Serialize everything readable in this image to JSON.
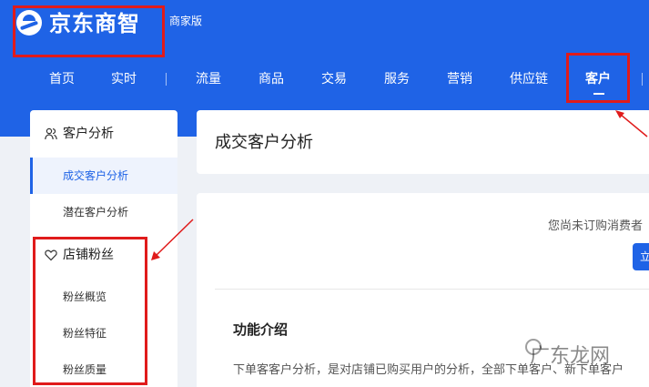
{
  "header": {
    "brand": "京东商智",
    "edition": "商家版"
  },
  "nav": {
    "items": [
      "首页",
      "实时",
      "流量",
      "商品",
      "交易",
      "服务",
      "营销",
      "供应链",
      "客户"
    ],
    "active": "客户"
  },
  "sidebar": {
    "groups": [
      {
        "label": "客户分析",
        "icon": "users-icon",
        "items": [
          "成交客户分析",
          "潜在客户分析"
        ]
      },
      {
        "label": "店铺粉丝",
        "icon": "heart-icon",
        "items": [
          "粉丝概览",
          "粉丝特征",
          "粉丝质量"
        ]
      }
    ],
    "active_item": "成交客户分析"
  },
  "page": {
    "title": "成交客户分析",
    "notice": "您尚未订购消费者",
    "button_label": "立",
    "feature_title": "功能介绍",
    "feature_desc": "下单客客户分析，是对店铺已购买用户的分析，全部下单客户、新下单客户"
  },
  "watermark": "广东龙网",
  "colors": {
    "brand_blue": "#1f63e6",
    "annotation_red": "#e01b1b"
  }
}
